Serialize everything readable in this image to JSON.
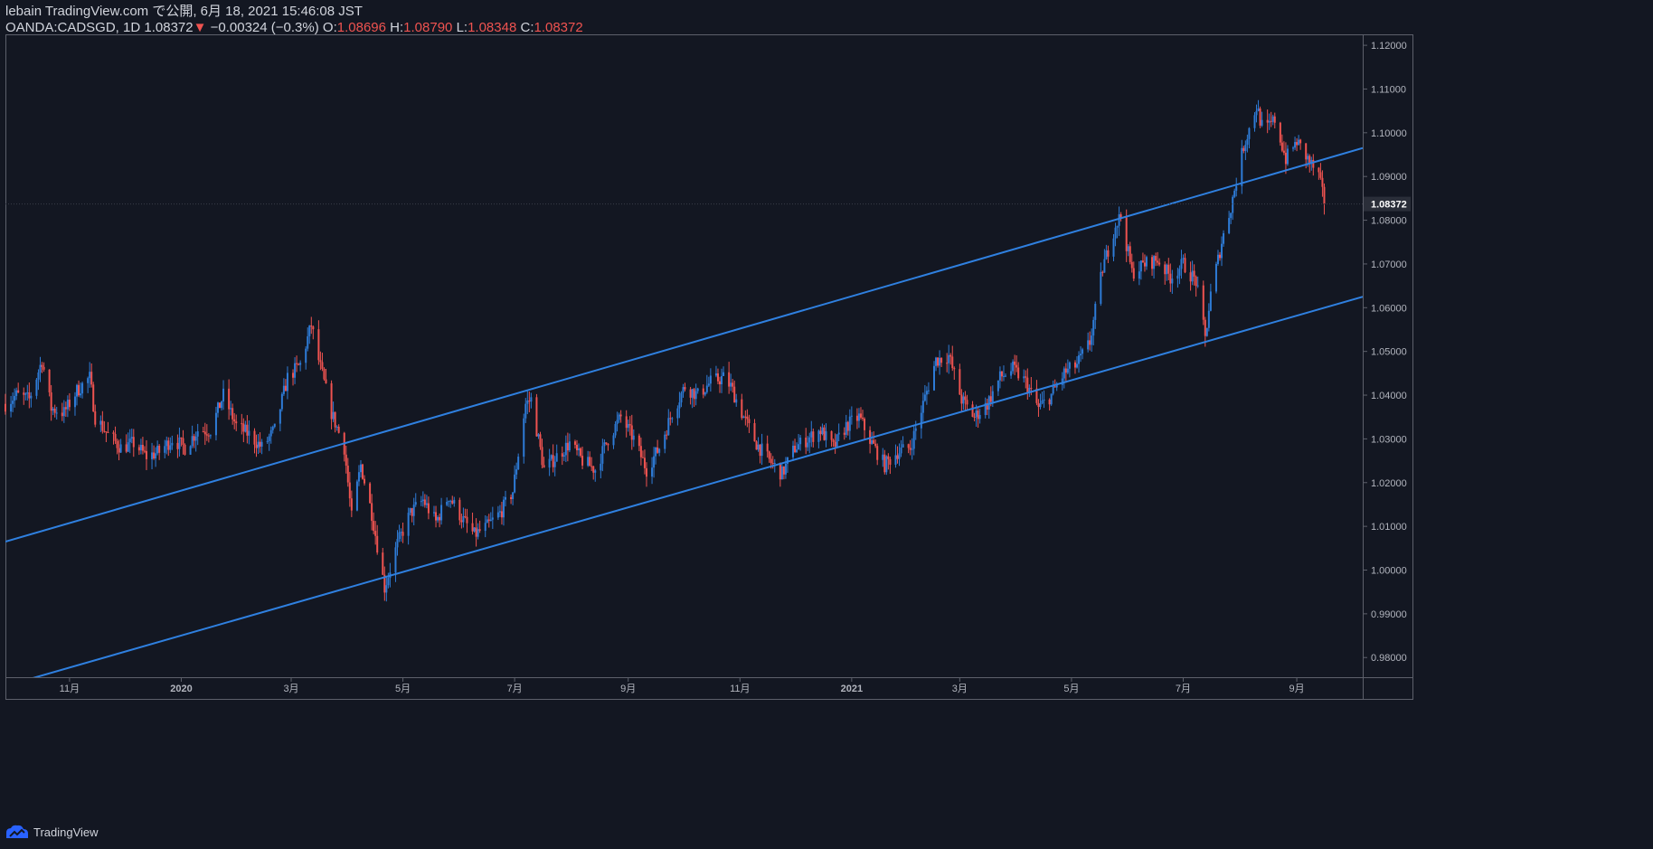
{
  "header": {
    "published": "lebain TradingView.com で公開, 6月 18, 2021 15:46:08 JST",
    "symbol_interval": "OANDA:CADSGD, 1D",
    "last": "1.08372",
    "change_arrow": "▼",
    "change": "−0.00324 (−0.3%)",
    "o_label": "O:",
    "o_value": "1.08696",
    "h_label": "H:",
    "h_value": "1.08790",
    "l_label": "L:",
    "l_value": "1.08348",
    "c_label": "C:",
    "c_value": "1.08372"
  },
  "footer": {
    "brand": "TradingView",
    "logo_icon": "tradingview-logo-icon"
  },
  "colors": {
    "background": "#131722",
    "up": "#2e7bd6",
    "down": "#ef5350",
    "trendline": "#2f80e0",
    "axis_text": "#b2b5be",
    "frame": "#5d606b",
    "price_tag_bg": "#2a2e39"
  },
  "chart_data": {
    "type": "candlestick",
    "symbol": "OANDA:CADSGD",
    "interval": "1D",
    "x_range": [
      "2019-09-27",
      "2021-10-07"
    ],
    "ylim": [
      0.9755,
      1.1225
    ],
    "y_ticks": [
      "1.12000",
      "1.11000",
      "1.10000",
      "1.09000",
      "1.08000",
      "1.07000",
      "1.06000",
      "1.05000",
      "1.04000",
      "1.03000",
      "1.02000",
      "1.01000",
      "1.00000",
      "0.99000",
      "0.98000"
    ],
    "x_ticks": [
      {
        "date": "2019-11-01",
        "label": "11月"
      },
      {
        "date": "2020-01-01",
        "label": "2020"
      },
      {
        "date": "2020-03-01",
        "label": "3月"
      },
      {
        "date": "2020-05-01",
        "label": "5月"
      },
      {
        "date": "2020-07-01",
        "label": "7月"
      },
      {
        "date": "2020-09-01",
        "label": "9月"
      },
      {
        "date": "2020-11-01",
        "label": "11月"
      },
      {
        "date": "2021-01-01",
        "label": "2021"
      },
      {
        "date": "2021-03-01",
        "label": "3月"
      },
      {
        "date": "2021-05-01",
        "label": "5月"
      },
      {
        "date": "2021-07-01",
        "label": "7月"
      },
      {
        "date": "2021-09-01",
        "label": "9月"
      }
    ],
    "last_price": "1.08372",
    "close_path": [
      [
        "2019-09-27",
        1.038
      ],
      [
        "2019-10-03",
        1.04
      ],
      [
        "2019-10-10",
        1.039
      ],
      [
        "2019-10-17",
        1.048
      ],
      [
        "2019-10-22",
        1.037
      ],
      [
        "2019-10-29",
        1.036
      ],
      [
        "2019-11-05",
        1.041
      ],
      [
        "2019-11-12",
        1.044
      ],
      [
        "2019-11-15",
        1.035
      ],
      [
        "2019-11-22",
        1.031
      ],
      [
        "2019-11-29",
        1.028
      ],
      [
        "2019-12-06",
        1.029
      ],
      [
        "2019-12-13",
        1.026
      ],
      [
        "2019-12-20",
        1.027
      ],
      [
        "2019-12-27",
        1.03
      ],
      [
        "2020-01-03",
        1.028
      ],
      [
        "2020-01-10",
        1.032
      ],
      [
        "2020-01-17",
        1.032
      ],
      [
        "2020-01-24",
        1.04
      ],
      [
        "2020-01-31",
        1.033
      ],
      [
        "2020-02-07",
        1.031
      ],
      [
        "2020-02-14",
        1.028
      ],
      [
        "2020-02-21",
        1.032
      ],
      [
        "2020-02-28",
        1.044
      ],
      [
        "2020-03-06",
        1.047
      ],
      [
        "2020-03-12",
        1.056
      ],
      [
        "2020-03-16",
        1.048
      ],
      [
        "2020-03-23",
        1.036
      ],
      [
        "2020-03-30",
        1.028
      ],
      [
        "2020-04-03",
        1.012
      ],
      [
        "2020-04-08",
        1.024
      ],
      [
        "2020-04-14",
        1.013
      ],
      [
        "2020-04-21",
        0.996
      ],
      [
        "2020-04-28",
        1.006
      ],
      [
        "2020-05-05",
        1.013
      ],
      [
        "2020-05-12",
        1.016
      ],
      [
        "2020-05-19",
        1.011
      ],
      [
        "2020-05-26",
        1.017
      ],
      [
        "2020-06-02",
        1.012
      ],
      [
        "2020-06-09",
        1.008
      ],
      [
        "2020-06-16",
        1.01
      ],
      [
        "2020-06-23",
        1.013
      ],
      [
        "2020-06-30",
        1.018
      ],
      [
        "2020-07-07",
        1.038
      ],
      [
        "2020-07-10",
        1.039
      ],
      [
        "2020-07-17",
        1.023
      ],
      [
        "2020-07-24",
        1.026
      ],
      [
        "2020-07-31",
        1.029
      ],
      [
        "2020-08-07",
        1.025
      ],
      [
        "2020-08-14",
        1.023
      ],
      [
        "2020-08-21",
        1.03
      ],
      [
        "2020-08-28",
        1.035
      ],
      [
        "2020-09-04",
        1.03
      ],
      [
        "2020-09-11",
        1.023
      ],
      [
        "2020-09-18",
        1.028
      ],
      [
        "2020-09-25",
        1.036
      ],
      [
        "2020-10-02",
        1.042
      ],
      [
        "2020-10-09",
        1.04
      ],
      [
        "2020-10-16",
        1.043
      ],
      [
        "2020-10-23",
        1.044
      ],
      [
        "2020-10-27",
        1.042
      ],
      [
        "2020-11-03",
        1.035
      ],
      [
        "2020-11-10",
        1.029
      ],
      [
        "2020-11-17",
        1.025
      ],
      [
        "2020-11-24",
        1.022
      ],
      [
        "2020-12-01",
        1.028
      ],
      [
        "2020-12-08",
        1.03
      ],
      [
        "2020-12-15",
        1.032
      ],
      [
        "2020-12-22",
        1.028
      ],
      [
        "2020-12-29",
        1.033
      ],
      [
        "2021-01-05",
        1.035
      ],
      [
        "2021-01-12",
        1.029
      ],
      [
        "2021-01-19",
        1.024
      ],
      [
        "2021-01-26",
        1.027
      ],
      [
        "2021-02-02",
        1.028
      ],
      [
        "2021-02-09",
        1.038
      ],
      [
        "2021-02-16",
        1.048
      ],
      [
        "2021-02-23",
        1.049
      ],
      [
        "2021-03-02",
        1.039
      ],
      [
        "2021-03-09",
        1.035
      ],
      [
        "2021-03-16",
        1.038
      ],
      [
        "2021-03-23",
        1.044
      ],
      [
        "2021-03-30",
        1.046
      ],
      [
        "2021-04-06",
        1.043
      ],
      [
        "2021-04-13",
        1.037
      ],
      [
        "2021-04-20",
        1.04
      ],
      [
        "2021-04-27",
        1.045
      ],
      [
        "2021-05-04",
        1.047
      ],
      [
        "2021-05-11",
        1.052
      ],
      [
        "2021-05-18",
        1.069
      ],
      [
        "2021-05-25",
        1.079
      ],
      [
        "2021-05-28",
        1.081
      ],
      [
        "2021-06-03",
        1.068
      ],
      [
        "2021-06-10",
        1.07
      ],
      [
        "2021-06-17",
        1.071
      ],
      [
        "2021-06-24",
        1.067
      ],
      [
        "2021-07-01",
        1.07
      ],
      [
        "2021-07-08",
        1.066
      ],
      [
        "2021-07-13",
        1.053
      ],
      [
        "2021-07-16",
        1.063
      ],
      [
        "2021-07-22",
        1.075
      ],
      [
        "2021-07-27",
        1.083
      ],
      [
        "2021-08-03",
        1.097
      ],
      [
        "2021-08-10",
        1.106
      ],
      [
        "2021-08-14",
        1.1
      ],
      [
        "2021-08-20",
        1.103
      ],
      [
        "2021-08-26",
        1.094
      ],
      [
        "2021-09-01",
        1.098
      ],
      [
        "2021-09-07",
        1.094
      ],
      [
        "2021-09-13",
        1.09
      ],
      [
        "2021-09-16",
        1.084
      ]
    ],
    "trendlines": [
      {
        "name": "upper-channel",
        "points": [
          [
            "2019-09-27",
            1.0065
          ],
          [
            "2021-10-07",
            1.0965
          ]
        ]
      },
      {
        "name": "lower-channel",
        "points": [
          [
            "2019-09-27",
            0.9735
          ],
          [
            "2021-10-07",
            1.0625
          ]
        ]
      }
    ]
  }
}
